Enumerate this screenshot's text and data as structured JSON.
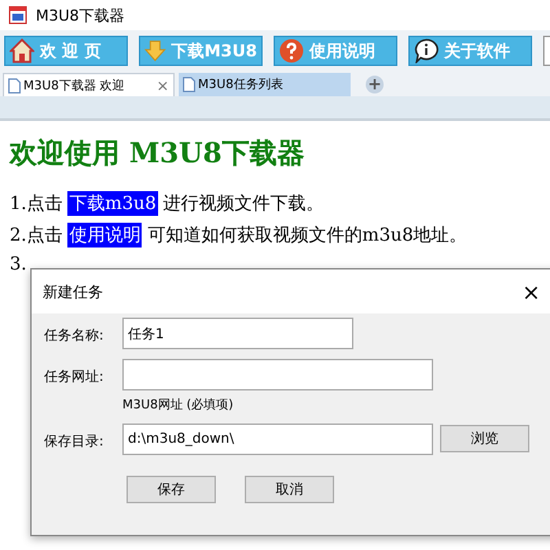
{
  "window": {
    "title": "M3U8下载器"
  },
  "toolbar": [
    {
      "kind": "home",
      "label": "欢 迎 页"
    },
    {
      "kind": "download",
      "label": "下载M3U8"
    },
    {
      "kind": "help",
      "label": "使用说明"
    },
    {
      "kind": "about",
      "label": "关于软件"
    }
  ],
  "tabs": [
    {
      "label": "M3U8下载器 欢迎",
      "selected": true,
      "close": "×"
    },
    {
      "label": "M3U8任务列表",
      "selected": false
    }
  ],
  "new_tab": "+",
  "content": {
    "heading": "欢迎使用 M3U8下载器",
    "lines": [
      {
        "number": "1.点击",
        "link": "下载m3u8",
        "text": "进行视频文件下载。"
      },
      {
        "number": "2.点击",
        "link": "使用说明",
        "text": "可知道如何获取视频文件的m3u8地址。"
      },
      {
        "number": "3."
      }
    ]
  },
  "dialog": {
    "title": "新建任务",
    "close": "×",
    "fields": [
      {
        "label": "任务名称:",
        "value": "任务1"
      },
      {
        "label": "任务网址:",
        "hint": "M3U8网址 (必填项)"
      },
      {
        "label": "保存目录:",
        "value": "d:\\m3u8_down\\",
        "button": "浏览"
      }
    ],
    "buttons": [
      "保存",
      "取消"
    ]
  }
}
